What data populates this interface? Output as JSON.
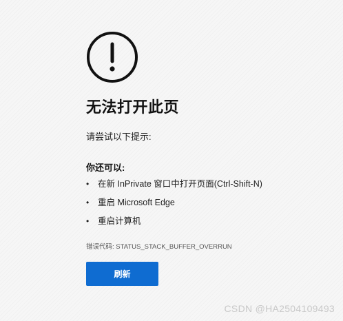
{
  "page": {
    "title": "无法打开此页",
    "hint_intro": "请尝试以下提示:",
    "options_heading": "你还可以:",
    "options": [
      "在新 InPrivate 窗口中打开页面(Ctrl-Shift-N)",
      "重启 Microsoft Edge",
      "重启计算机"
    ],
    "error_code": "错误代码: STATUS_STACK_BUFFER_OVERRUN",
    "refresh_label": "刷新",
    "bullet": "•"
  },
  "watermark": "CSDN @HA2504109493",
  "icons": {
    "main": "exclamation-circle-icon"
  },
  "colors": {
    "background": "#f6f6f6",
    "button": "#0f6cd1",
    "text": "#1b1b1b",
    "watermark": "#c8c8c8"
  }
}
